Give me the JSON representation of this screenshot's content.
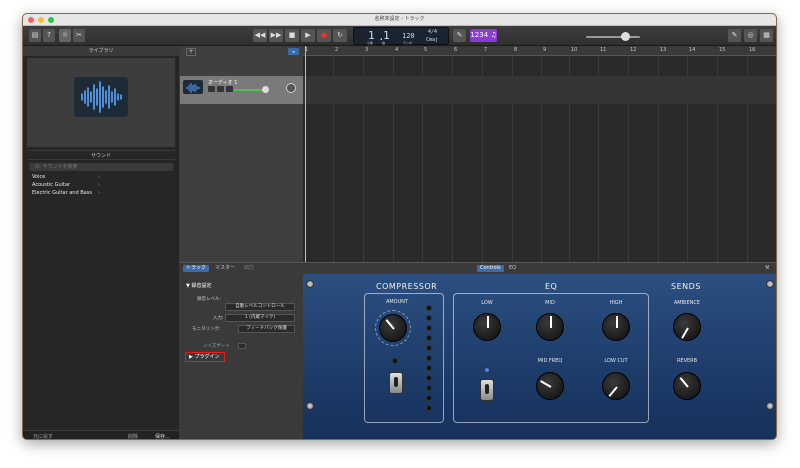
{
  "window": {
    "title": "名称未設定 - トラック"
  },
  "toolbar": {
    "lcd": {
      "bar": "1",
      "beat": "1",
      "bar_label": "小節",
      "beat_label": "拍",
      "tempo": "120",
      "tempo_label": "テンポ",
      "signature": "4/4",
      "key": "Cmaj"
    }
  },
  "library": {
    "title": "ライブラリ",
    "sound_heading": "サウンド",
    "search_placeholder": "Q- サウンドを検索",
    "categories": [
      "Voice",
      "Acoustic Guitar",
      "Electric Guitar and Bass"
    ],
    "revert_label": "元に戻す",
    "delete_label": "削除",
    "save_label": "保存..."
  },
  "tracks": {
    "items": [
      {
        "name": "オーディオ 1"
      }
    ],
    "ruler": [
      "1",
      "2",
      "3",
      "4",
      "5",
      "6",
      "7",
      "8",
      "9",
      "10",
      "11",
      "12",
      "13",
      "14",
      "15",
      "16"
    ]
  },
  "smart_controls": {
    "tabs": [
      "トラック",
      "マスター",
      "出力"
    ],
    "view_tabs": [
      "Controls",
      "EQ"
    ],
    "section_title": "録音設定",
    "rec_level_label": "録音レベル:",
    "rec_level_value": "自動レベルコントロール",
    "input_label": "入力:",
    "input_value": "1 (内蔵マイク)",
    "monitoring_label": "モニタリング:",
    "monitoring_value": "フィードバック保護",
    "noise_gate_label": "ノイズゲート",
    "plugins_label": "プラグイン"
  },
  "amp": {
    "compressor": {
      "title": "COMPRESSOR",
      "amount": "AMOUNT"
    },
    "eq": {
      "title": "EQ",
      "low": "LOW",
      "mid": "MID",
      "high": "HIGH",
      "mid_freq": "MID FREQ",
      "low_cut": "LOW CUT"
    },
    "sends": {
      "title": "SENDS",
      "ambience": "AMBIENCE",
      "reverb": "REVERB"
    }
  },
  "colors": {
    "accent_blue": "#3b6aa8",
    "highlight_red": "#e02020",
    "amp_blue": "#1e3d6b",
    "level_green": "#4fbf4f"
  }
}
